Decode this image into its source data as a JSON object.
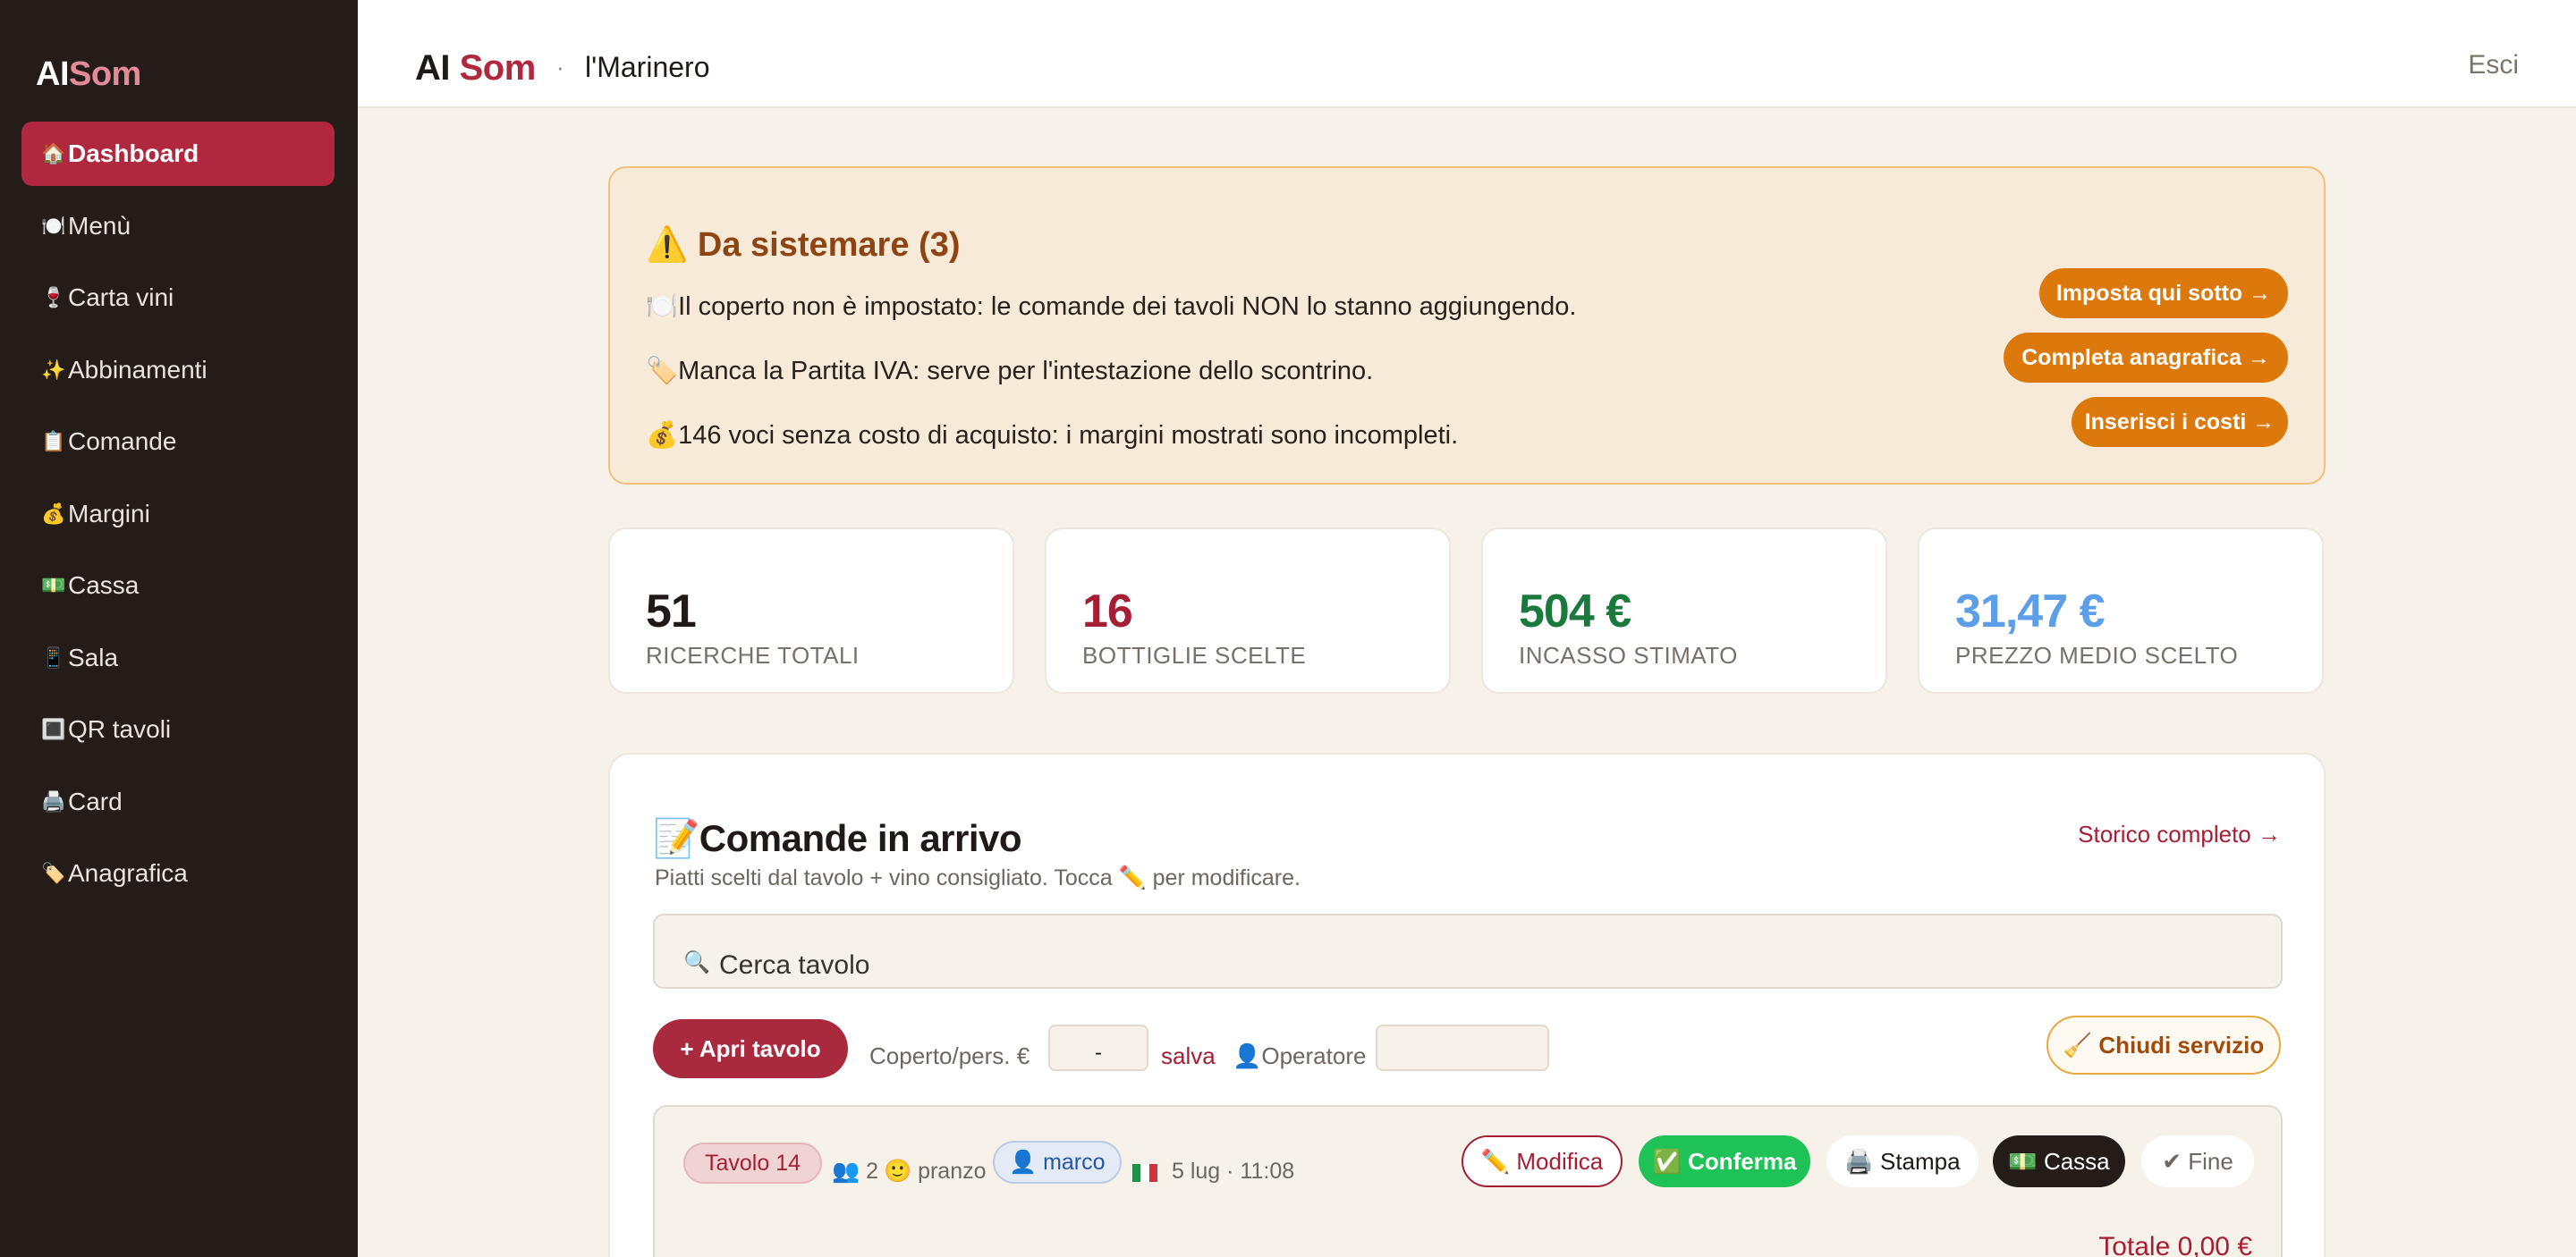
{
  "sidebar": {
    "logo_a": "AI",
    "logo_b": "Som",
    "items": [
      {
        "icon": "🏠",
        "label": "Dashboard",
        "active": true
      },
      {
        "icon": "🍽️",
        "label": "Menù"
      },
      {
        "icon": "🍷",
        "label": "Carta vini"
      },
      {
        "icon": "✨",
        "label": "Abbinamenti"
      },
      {
        "icon": "📋",
        "label": "Comande"
      },
      {
        "icon": "💰",
        "label": "Margini"
      },
      {
        "icon": "💵",
        "label": "Cassa"
      },
      {
        "icon": "📱",
        "label": "Sala"
      },
      {
        "icon": "🔳",
        "label": "QR tavoli"
      },
      {
        "icon": "🖨️",
        "label": "Card"
      },
      {
        "icon": "🏷️",
        "label": "Anagrafica"
      }
    ]
  },
  "header": {
    "brand_a": "AI",
    "brand_b": "Som",
    "separator": "·",
    "restaurant": "l'Marinero",
    "logout": "Esci"
  },
  "alert": {
    "icon": "⚠️",
    "title": "Da sistemare (3)",
    "items": [
      {
        "icon": "🍽️",
        "text": "Il coperto non è impostato: le comande dei tavoli NON lo stanno aggiungendo.",
        "action": "Imposta qui sotto →"
      },
      {
        "icon": "🏷️",
        "text": "Manca la Partita IVA: serve per l'intestazione dello scontrino.",
        "action": "Completa anagrafica →"
      },
      {
        "icon": "💰",
        "text": "146 voci senza costo di acquisto: i margini mostrati sono incompleti.",
        "action": "Inserisci i costi →"
      }
    ]
  },
  "stats": [
    {
      "value": "51",
      "label": "RICERCHE TOTALI",
      "color": "#1f1a17"
    },
    {
      "value": "16",
      "label": "BOTTIGLIE SCELTE",
      "color": "#a41f35"
    },
    {
      "value": "504 €",
      "label": "INCASSO STIMATO",
      "color": "#1a7a3e"
    },
    {
      "value": "31,47 €",
      "label": "PREZZO MEDIO SCELTO",
      "color": "#5d9ee8"
    }
  ],
  "orders": {
    "icon": "📝",
    "title": "Comande in arrivo",
    "subtitle": "Piatti scelti dal tavolo + vino consigliato. Tocca ✏️ per modificare.",
    "history_link": "Storico completo →",
    "search_icon": "🔍",
    "search_placeholder": "Cerca tavolo",
    "open_table": "+ Apri tavolo",
    "cover_label": "Coperto/pers. €",
    "cover_value": "-",
    "save": "salva",
    "operator_label": "👤Operatore",
    "close_service": "🧹 Chiudi servizio",
    "row": {
      "table": "Tavolo 14",
      "guests": "👥 2",
      "meal": "🙂 pranzo",
      "user": "👤 marco",
      "datetime": "5 lug · 11:08",
      "actions": {
        "edit": "✏️ Modifica",
        "confirm": "✅ Conferma",
        "print": "🖨️ Stampa",
        "cash": "💵 Cassa",
        "end": "✔ Fine"
      },
      "total": "Totale 0,00 €"
    }
  },
  "colors": {
    "accent": "#b0283f",
    "sidebar_bg": "#231c19",
    "warning": "#dc780c",
    "success": "#1fc257"
  }
}
